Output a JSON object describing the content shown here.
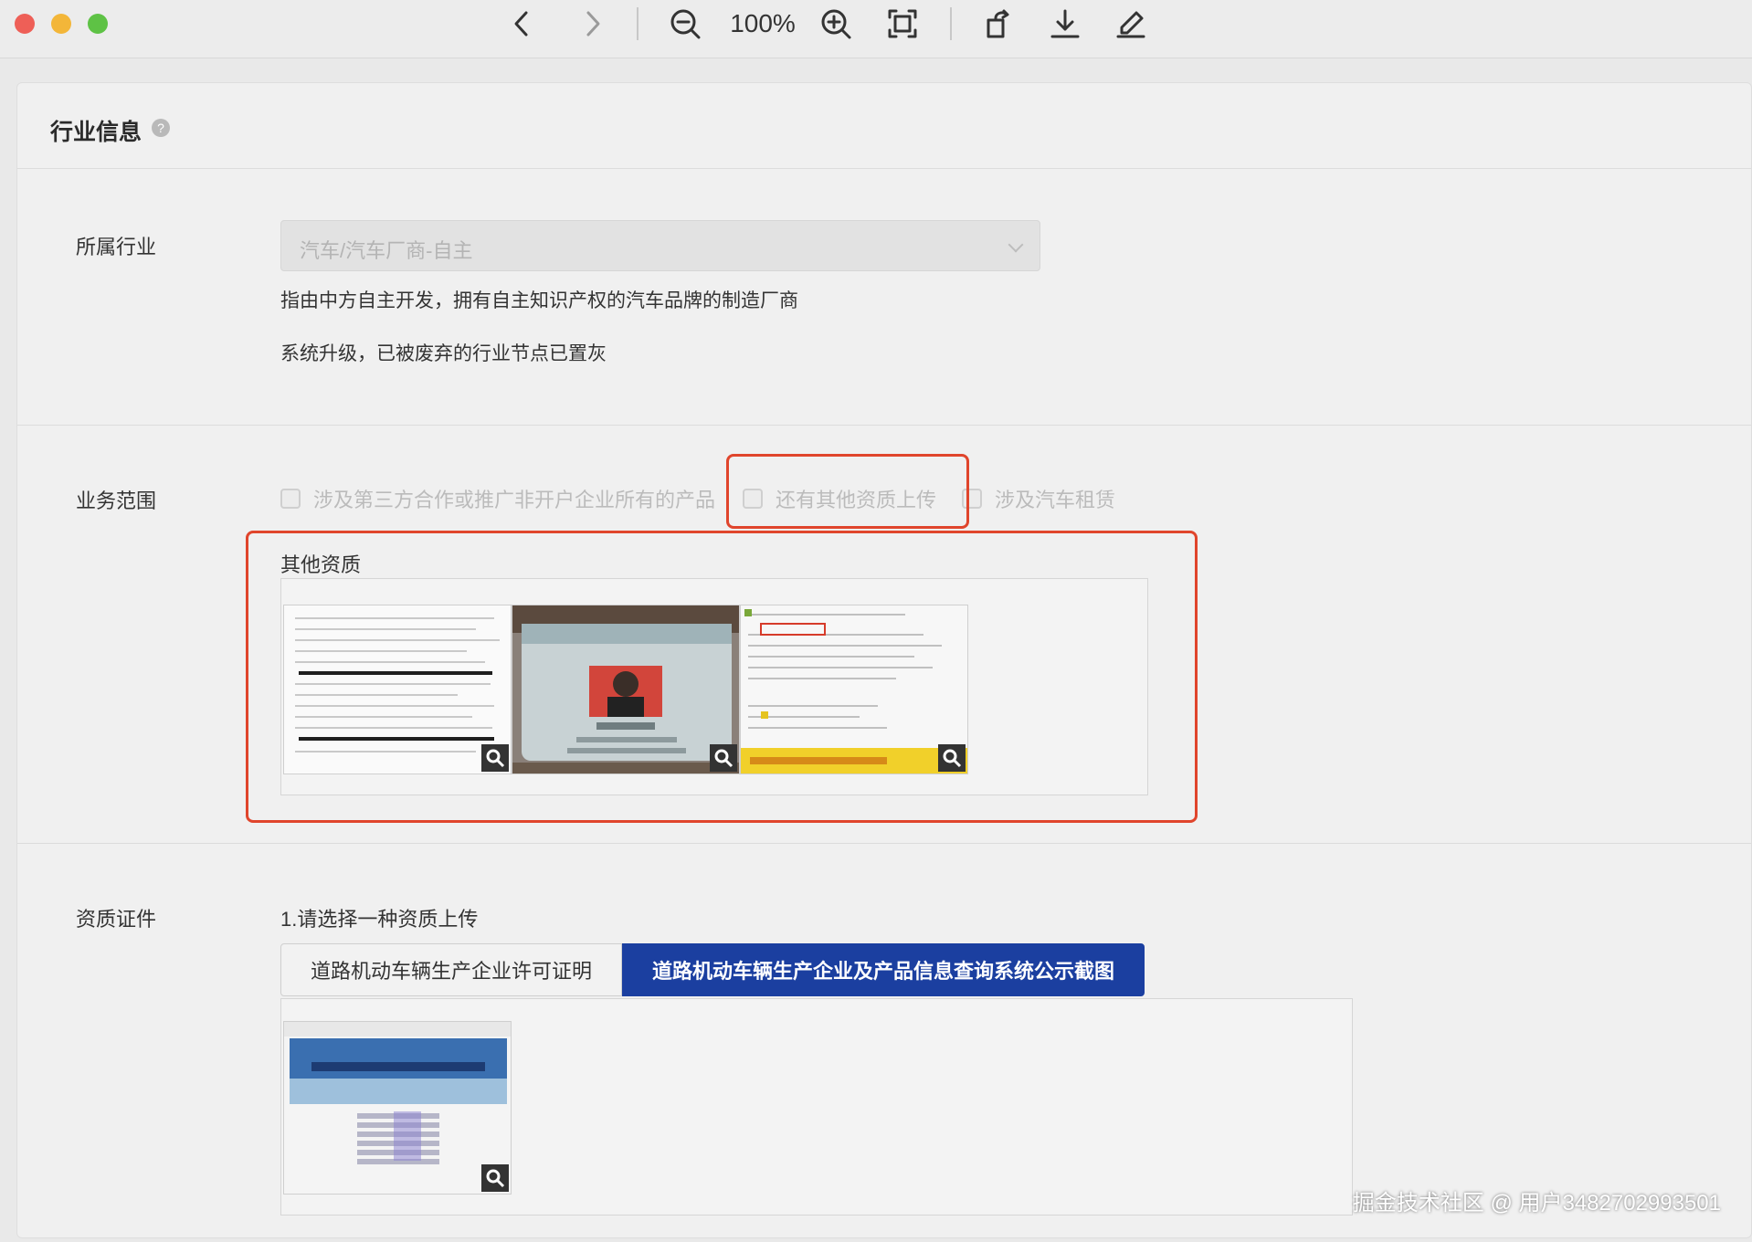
{
  "viewer": {
    "zoom_label": "100%",
    "buttons": [
      "back-icon",
      "forward-icon",
      "zoom-out-icon",
      "zoom-in-icon",
      "fit-screen-icon",
      "rotate-icon",
      "download-icon",
      "edit-icon"
    ]
  },
  "section": {
    "title": "行业信息",
    "help": "?"
  },
  "industry": {
    "label": "所属行业",
    "value": "汽车/汽车厂商-自主",
    "hint1": "指由中方自主开发，拥有自主知识产权的汽车品牌的制造厂商",
    "hint2": "系统升级，已被废弃的行业节点已置灰"
  },
  "business_scope": {
    "label": "业务范围",
    "options": [
      {
        "label": "涉及第三方合作或推广非开户企业所有的产品",
        "checked": false
      },
      {
        "label": "还有其他资质上传",
        "checked": false
      },
      {
        "label": "涉及汽车租赁",
        "checked": false
      }
    ]
  },
  "other_qualifications": {
    "title": "其他资质",
    "images": [
      "document-scan",
      "id-card-photo",
      "web-screenshot"
    ]
  },
  "qualification_cert": {
    "label": "资质证件",
    "instruction": "1.请选择一种资质上传",
    "tabs": [
      {
        "label": "道路机动车辆生产企业许可证明",
        "active": false
      },
      {
        "label": "道路机动车辆生产企业及产品信息查询系统公示截图",
        "active": true
      }
    ],
    "images": [
      "system-screenshot"
    ]
  },
  "watermark": "掘金技术社区 @ 用户3482702993501",
  "colors": {
    "highlight": "#e0452c",
    "active_tab": "#1b3fa0"
  }
}
